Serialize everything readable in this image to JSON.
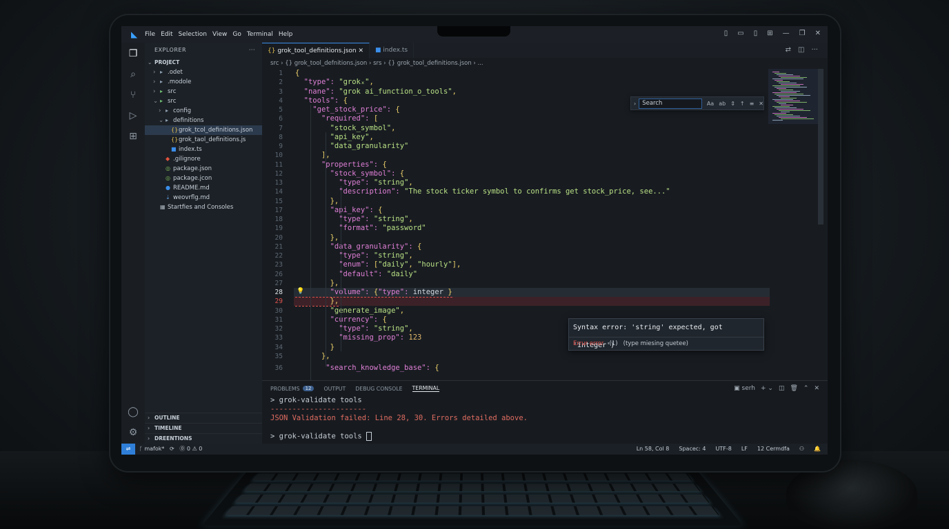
{
  "window": {
    "menu": [
      "File",
      "Edit",
      "Selection",
      "View",
      "Go",
      "Terminal",
      "Help"
    ],
    "controls": [
      "▯",
      "▭",
      "▯",
      "⊞",
      "—",
      "❐",
      "✕"
    ]
  },
  "sidebar": {
    "title": "EXPLORER",
    "more": "···",
    "project": "PROJECT",
    "items": [
      {
        "label": ".odet",
        "indent": 1,
        "tw": "›",
        "icon": "folder"
      },
      {
        "label": ".modole",
        "indent": 1,
        "tw": "›",
        "icon": "folder"
      },
      {
        "label": "src",
        "indent": 1,
        "tw": "›",
        "icon": "folder-green"
      },
      {
        "label": "src",
        "indent": 1,
        "tw": "⌄",
        "icon": "folder-green"
      },
      {
        "label": "config",
        "indent": 2,
        "tw": "›",
        "icon": "folder"
      },
      {
        "label": "definitions",
        "indent": 2,
        "tw": "⌄",
        "icon": "folder"
      },
      {
        "label": "grok_tcol_definitions.json",
        "indent": 3,
        "tw": "",
        "icon": "json",
        "selected": true
      },
      {
        "label": "grok_taol_definitions.js",
        "indent": 3,
        "tw": "",
        "icon": "json"
      },
      {
        "label": "index.ts",
        "indent": 3,
        "tw": "",
        "icon": "ts"
      },
      {
        "label": ".gilignore",
        "indent": 2,
        "tw": "",
        "icon": "git"
      },
      {
        "label": "package.json",
        "indent": 2,
        "tw": "",
        "icon": "npm"
      },
      {
        "label": "package.jcon",
        "indent": 2,
        "tw": "",
        "icon": "npm"
      },
      {
        "label": "README.md",
        "indent": 2,
        "tw": "",
        "icon": "info"
      },
      {
        "label": "weovrflg.md",
        "indent": 2,
        "tw": "",
        "icon": "md"
      },
      {
        "label": "Startfies and Consoles",
        "indent": 1,
        "tw": "",
        "icon": "stack"
      }
    ],
    "footer": [
      "OUTLINE",
      "TIMELINE",
      "DREENTIONS"
    ]
  },
  "editor": {
    "tabs": [
      {
        "label": "grok_tool_definitions.json",
        "icon": "{}",
        "active": true,
        "close": "✕"
      },
      {
        "label": "index.ts",
        "icon": "TS",
        "active": false
      }
    ],
    "breadcrumb": "src  ›  {} grok_tool_defnitions.json  ›  srs  ›  {} grok_tool_definitions.json  ›  ...",
    "find": {
      "placeholder": "Search",
      "case": "Aa",
      "word": "ab"
    },
    "hover": {
      "title": "Syntax error: 'string' expected, got 'integer')",
      "kind": "Errur error",
      "count": "(1)",
      "detail": "(type miesing quetee)"
    }
  },
  "code_lines": [
    {
      "n": "1",
      "t": "{"
    },
    {
      "n": "2",
      "t": "  \"type\": \"grokₓ\","
    },
    {
      "n": "3",
      "t": "  \"nane\": \"grok ai_function_o_tools\","
    },
    {
      "n": "4",
      "t": "  \"tools\": {"
    },
    {
      "n": "5",
      "t": "    \"get_stock_price\": {"
    },
    {
      "n": "6",
      "t": "      \"required\": ["
    },
    {
      "n": "7",
      "t": "        \"stock_symbol\","
    },
    {
      "n": "8",
      "t": "        \"api_key\","
    },
    {
      "n": "9",
      "t": "        \"data_granularity\""
    },
    {
      "n": "10",
      "t": "      ],"
    },
    {
      "n": "11",
      "t": "      \"properties\": {"
    },
    {
      "n": "12",
      "t": "        \"stock_symbol\": {"
    },
    {
      "n": "13",
      "t": "          \"type\": \"string\","
    },
    {
      "n": "14",
      "t": "          \"description\": \"The stock ticker symbol to confirms get stock_price, see...\""
    },
    {
      "n": "15",
      "t": "        },"
    },
    {
      "n": "17",
      "t": "        \"api_key\": {"
    },
    {
      "n": "18",
      "t": "          \"type\": \"string\","
    },
    {
      "n": "19",
      "t": "          \"format\": \"password\""
    },
    {
      "n": "20",
      "t": "        },"
    },
    {
      "n": "21",
      "t": "        \"data_granularity\": {"
    },
    {
      "n": "22",
      "t": "          \"type\": \"string\","
    },
    {
      "n": "23",
      "t": "          \"enum\": [\"daily\", \"hourly\"],"
    },
    {
      "n": "26",
      "t": "          \"default\": \"daily\""
    },
    {
      "n": "27",
      "t": "        },"
    },
    {
      "n": "28",
      "t": "        \"volume\": {\"type\": integer }"
    },
    {
      "n": "29",
      "t": "        },"
    },
    {
      "n": "30",
      "t": "        \"generate_image\","
    },
    {
      "n": "31",
      "t": "        \"currency\": {"
    },
    {
      "n": "32",
      "t": "          \"type\": \"string\","
    },
    {
      "n": "33",
      "t": "          \"missing_prop\": 123"
    },
    {
      "n": "34",
      "t": "        }"
    },
    {
      "n": "35",
      "t": "      },"
    },
    {
      "n": "36",
      "t": "       \"search_knowledge_base\": {"
    }
  ],
  "panel": {
    "tabs": [
      "PROBLEMS",
      "OUTPUT",
      "DEBUG CONSOLE",
      "TERMINAL"
    ],
    "problems_count": "12",
    "shell": "serh",
    "lines": [
      {
        "text": "> grok-validate tools",
        "red": false
      },
      {
        "text": "----------------------",
        "red": true
      },
      {
        "text": "JSON Validation failed: Line 28, 30. Errors detailed above.",
        "red": true
      },
      {
        "text": "",
        "red": false
      },
      {
        "text": "> grok-validate tools ",
        "red": false
      }
    ]
  },
  "statusbar": {
    "branch": "mafok*",
    "errors": "⓪ 0 ⚠ 0",
    "position": "Ln 58, Col 8",
    "spaces": "Spacec: 4",
    "encoding": "UTF-8",
    "eol": "LF",
    "lang": "12 Cermdfa"
  }
}
